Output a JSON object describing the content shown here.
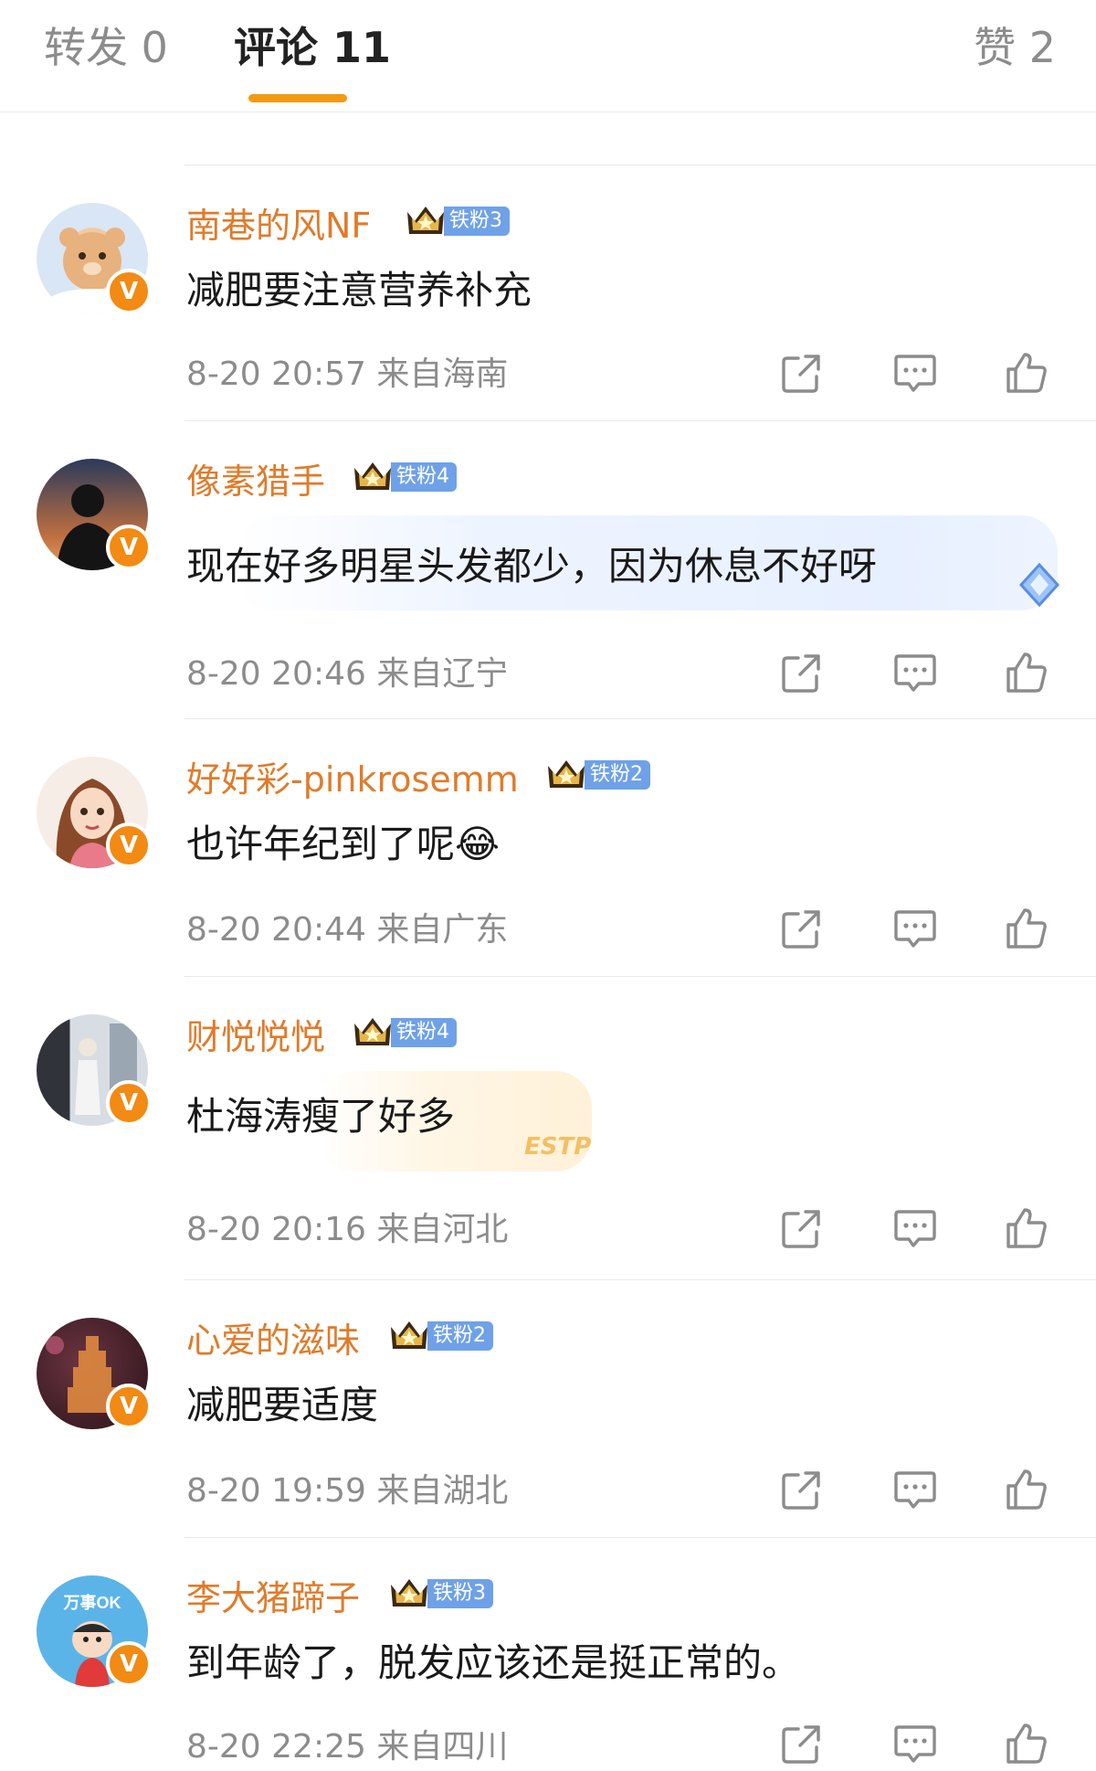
{
  "tabs": {
    "repost": "转发 0",
    "comments": "评论 11",
    "likes": "赞 2"
  },
  "colors": {
    "accent": "#f29a12",
    "username": "#e07b2a",
    "fan_badge": "#6fa1e8",
    "verified": "#f28a13",
    "meta": "#8c8c8c"
  },
  "comments": [
    {
      "username": "南巷的风NF",
      "fan_badge": "铁粉3",
      "text": "减肥要注意营养补充",
      "time": "8-20 20:57",
      "location": "来自海南",
      "avatar": "teddy-bear-avatar"
    },
    {
      "username": "像素猎手",
      "fan_badge": "铁粉4",
      "text": "现在好多明星头发都少，因为休息不好呀",
      "time": "8-20 20:46",
      "location": "来自辽宁",
      "avatar": "silhouette-sunset-avatar"
    },
    {
      "username": "好好彩-pinkrosemm",
      "fan_badge": "铁粉2",
      "text": "也许年纪到了呢😂",
      "time": "8-20 20:44",
      "location": "来自广东",
      "avatar": "cartoon-girl-avatar"
    },
    {
      "username": "财悦悦悦",
      "fan_badge": "铁粉4",
      "text": "杜海涛瘦了好多",
      "time": "8-20 20:16",
      "location": "来自河北",
      "avatar": "gym-photo-avatar",
      "bubble_tag": "ESTP"
    },
    {
      "username": "心爱的滋味",
      "fan_badge": "铁粉2",
      "text": "减肥要适度",
      "time": "8-20 19:59",
      "location": "来自湖北",
      "avatar": "pagoda-night-avatar"
    },
    {
      "username": "李大猪蹄子",
      "fan_badge": "铁粉3",
      "text": "到年龄了，脱发应该还是挺正常的。",
      "time": "8-20 22:25",
      "location": "来自四川",
      "avatar": "crayon-shin-chan-avatar",
      "avatar_text": "万事OK"
    }
  ],
  "icons": {
    "verified": "V",
    "repost": "share-icon",
    "reply": "comment-icon",
    "like": "thumbs-up-icon"
  }
}
